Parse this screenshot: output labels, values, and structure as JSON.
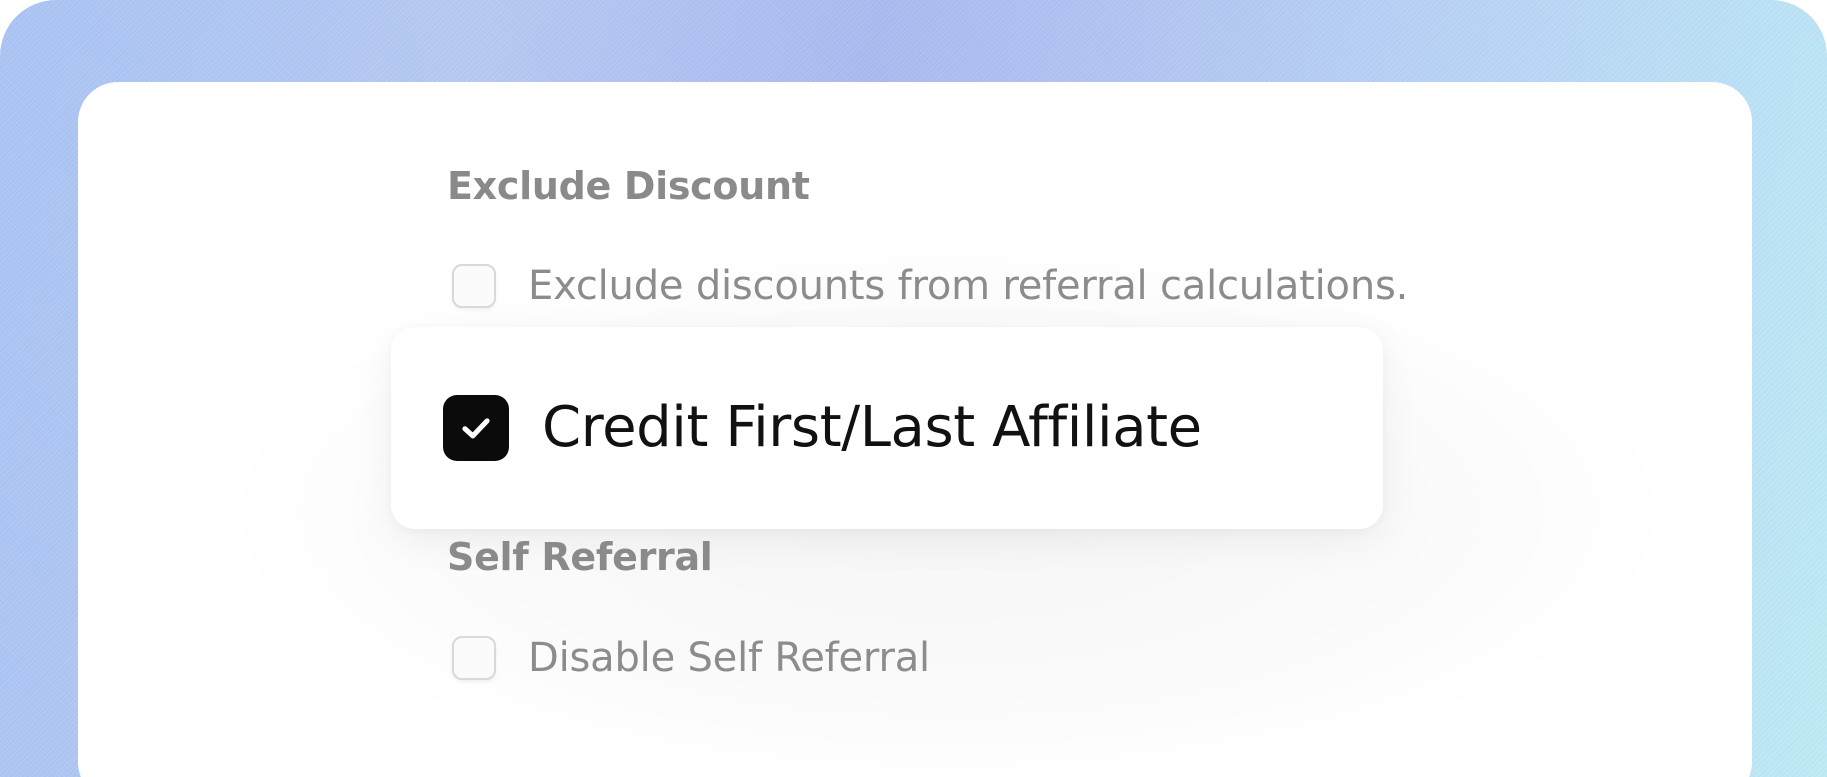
{
  "colors": {
    "background_gradient_start": "#a9c3f2",
    "background_gradient_end": "#bdeaf4",
    "card": "#ffffff",
    "checked_box": "#0b0b0c",
    "faded_text": "#8c8c8c"
  },
  "sections": {
    "exclude_discount": {
      "heading": "Exclude Discount",
      "option_label": "Exclude discounts from referral calculations.",
      "checked": false
    },
    "credit_affiliate": {
      "option_label": "Credit First/Last Affiliate",
      "checked": true,
      "icon": "checkmark-icon"
    },
    "self_referral": {
      "heading": "Self Referral",
      "option_label": "Disable Self Referral",
      "checked": false
    }
  }
}
